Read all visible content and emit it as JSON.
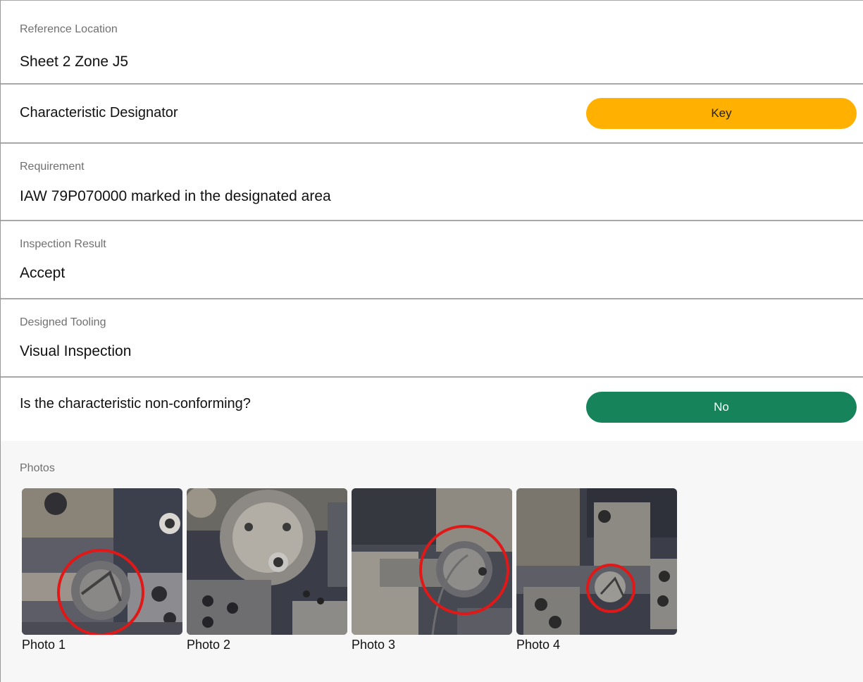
{
  "fields": {
    "reference_location": {
      "label": "Reference Location",
      "value": "Sheet 2 Zone J5"
    },
    "characteristic_designator": {
      "label": "Characteristic Designator",
      "value": "Key",
      "color": "#ffb000"
    },
    "requirement": {
      "label": "Requirement",
      "value": "IAW 79P070000 marked in the designated area"
    },
    "inspection_result": {
      "label": "Inspection Result",
      "value": "Accept"
    },
    "designed_tooling": {
      "label": "Designed Tooling",
      "value": "Visual Inspection"
    },
    "non_conforming": {
      "label": "Is the characteristic non-conforming?",
      "value": "No",
      "color": "#16835a"
    }
  },
  "photos": {
    "label": "Photos",
    "items": [
      {
        "caption": "Photo 1"
      },
      {
        "caption": "Photo 2"
      },
      {
        "caption": "Photo 3"
      },
      {
        "caption": "Photo 4"
      }
    ]
  }
}
